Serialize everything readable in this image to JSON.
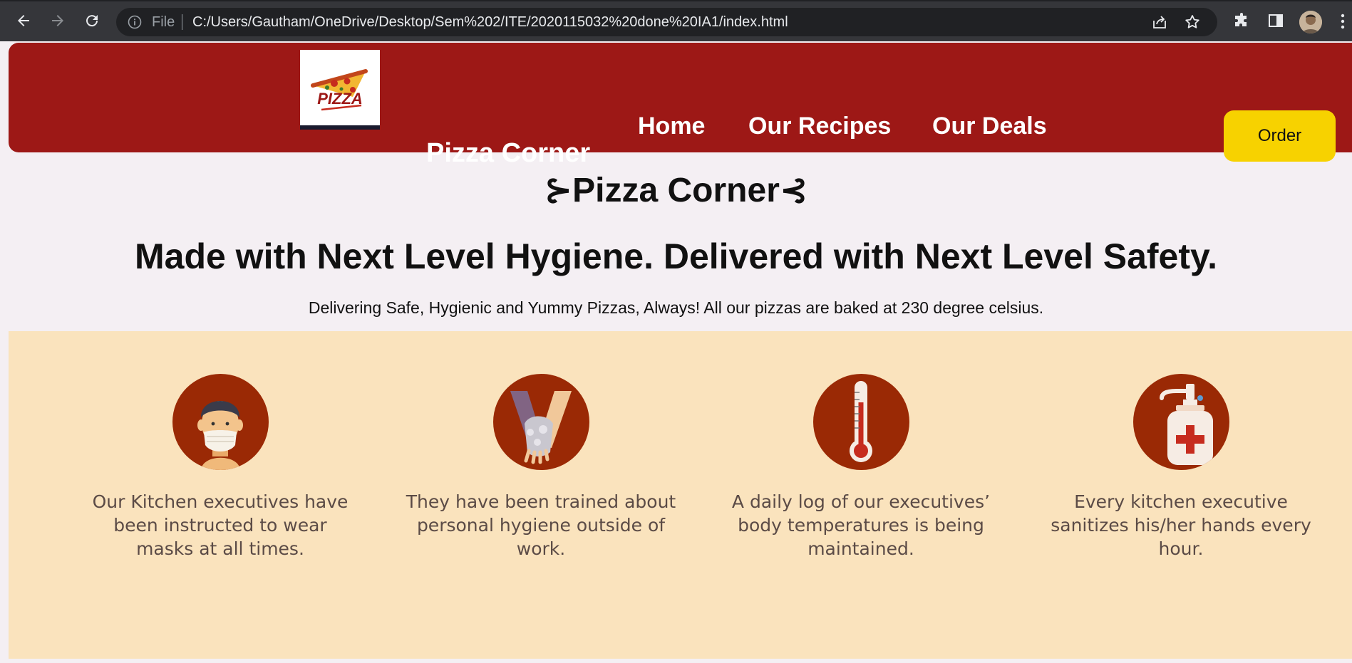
{
  "browser": {
    "file_label": "File",
    "url": "C:/Users/Gautham/OneDrive/Desktop/Sem%202/ITE/2020115032%20done%20IA1/index.html"
  },
  "header": {
    "logo_text": "PIZZA",
    "brand": "Pizza Corner",
    "nav": [
      "Home",
      "Our Recipes",
      "Our Deals"
    ],
    "order_label": "Order"
  },
  "hero": {
    "title": "⊱Pizza Corner⊰",
    "tagline": "Made with Next Level Hygiene. Delivered with Next Level Safety.",
    "subline": "Delivering Safe, Hygienic and Yummy Pizzas, Always! All our pizzas are baked at 230 degree celsius."
  },
  "features": [
    {
      "icon": "mask-icon",
      "text": "Our Kitchen executives have been instructed to wear masks at all times."
    },
    {
      "icon": "hand-wash-icon",
      "text": "They have been trained about personal hygiene outside of work."
    },
    {
      "icon": "thermometer-icon",
      "text": "A daily log of our executives’ body temperatures is being maintained."
    },
    {
      "icon": "sanitizer-icon",
      "text": "Every kitchen executive sanitizes his/her hands every hour."
    }
  ],
  "colors": {
    "header_bg": "#9d1816",
    "order_bg": "#f7d200",
    "section_bg": "#fae3bd",
    "icon_circle": "#9a2905"
  }
}
